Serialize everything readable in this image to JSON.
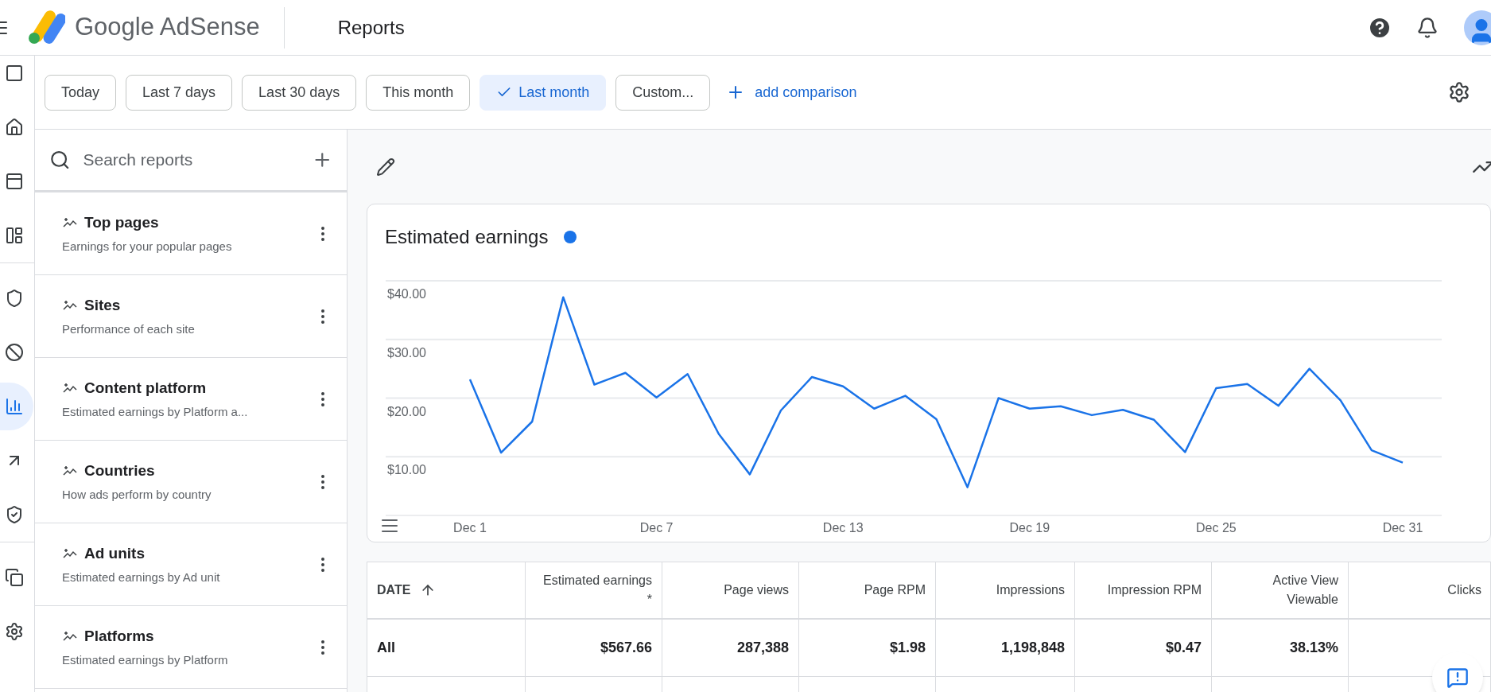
{
  "header": {
    "product": "Google AdSense",
    "page_title": "Reports"
  },
  "nav_groups": [
    {
      "items": [
        {
          "selected": false
        },
        {
          "selected": false
        },
        {
          "selected": false
        },
        {
          "selected": false
        }
      ]
    },
    {
      "items": [
        {
          "selected": false
        },
        {
          "selected": false
        },
        {
          "selected": true
        },
        {
          "selected": false
        },
        {
          "selected": false
        }
      ]
    },
    {
      "items": [
        {
          "selected": false
        },
        {
          "selected": false
        }
      ]
    }
  ],
  "date_filters": [
    {
      "label": "Today",
      "selected": false
    },
    {
      "label": "Last 7 days",
      "selected": false
    },
    {
      "label": "Last 30 days",
      "selected": false
    },
    {
      "label": "This month",
      "selected": false
    },
    {
      "label": "Last month",
      "selected": true
    },
    {
      "label": "Custom...",
      "selected": false
    }
  ],
  "add_comparison": "add comparison",
  "report_search": {
    "placeholder": "Search reports"
  },
  "reports": [
    {
      "title": "Top pages",
      "description": "Earnings for your popular pages"
    },
    {
      "title": "Sites",
      "description": "Performance of each site"
    },
    {
      "title": "Content platform",
      "description": "Estimated earnings by Platform a..."
    },
    {
      "title": "Countries",
      "description": "How ads perform by country"
    },
    {
      "title": "Ad units",
      "description": "Estimated earnings by Ad unit"
    },
    {
      "title": "Platforms",
      "description": "Estimated earnings by Platform"
    }
  ],
  "chart": {
    "chart_data": {
      "type": "line",
      "title": "Estimated earnings",
      "categories": [
        "Dec 1",
        null,
        null,
        null,
        null,
        null,
        "Dec 7",
        null,
        null,
        null,
        null,
        null,
        "Dec 13",
        null,
        null,
        null,
        null,
        null,
        "Dec 19",
        null,
        null,
        null,
        null,
        null,
        "Dec 25",
        null,
        null,
        null,
        null,
        null,
        "Dec 31"
      ],
      "series": [
        {
          "color": "#1a73e8",
          "values": [
            23.2,
            10.7,
            16.0,
            37.2,
            22.3,
            24.3,
            20.1,
            24.1,
            13.9,
            7.0,
            17.9,
            23.6,
            22.0,
            18.2,
            20.4,
            16.4,
            4.8,
            20.0,
            18.2,
            18.6,
            17.1,
            18.0,
            16.3,
            10.8,
            21.7,
            22.4,
            18.7,
            25.0,
            19.6,
            11.1,
            9.0
          ]
        }
      ],
      "ylim": [
        0,
        40
      ],
      "grid": true,
      "yticks": [
        {
          "value": 10,
          "label": "$10.00"
        },
        {
          "value": 20,
          "label": "$20.00"
        },
        {
          "value": 30,
          "label": "$30.00"
        },
        {
          "value": 40,
          "label": "$40.00"
        }
      ]
    }
  },
  "table": {
    "columns": [
      "DATE",
      "Estimated earnings *",
      "Page views",
      "Page RPM",
      "Impressions",
      "Impression RPM",
      "Active View Viewable",
      "Clicks"
    ],
    "rows": [
      {
        "cells": [
          "All",
          "$567.66",
          "287,388",
          "$1.98",
          "1,198,848",
          "$0.47",
          "38.13%"
        ]
      }
    ]
  }
}
